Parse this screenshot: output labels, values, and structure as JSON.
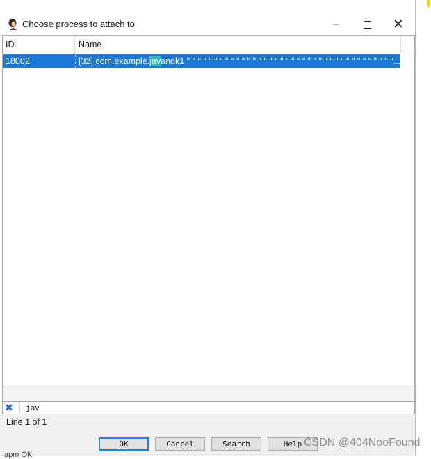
{
  "window": {
    "title": "Choose process to attach to",
    "close_glyph": "✕"
  },
  "table": {
    "columns": [
      "ID",
      "Name"
    ],
    "rows": [
      {
        "id": "18002",
        "name_prefix": "[32] com.example.",
        "name_match": "jav",
        "name_suffix": "andk1 \" \" \" \" \" \" \" \" \" \" \" \" \" \" \" \" \" \" \" \" \" \" \" \" \" \" \" \" \" \" \" \" \" \" \" \" \" \"..."
      }
    ]
  },
  "search": {
    "value": "jav",
    "clear_glyph": "✖"
  },
  "status": {
    "text": "Line 1 of 1"
  },
  "buttons": {
    "ok": "OK",
    "cancel": "Cancel",
    "search": "Search",
    "help": "Help"
  },
  "watermark": "CSDN @404NooFound",
  "background_text": "apm   OK",
  "colors": {
    "selection": "#1c79d5",
    "match_highlight": "#30b8b0",
    "clear_icon": "#2a6cd6"
  }
}
